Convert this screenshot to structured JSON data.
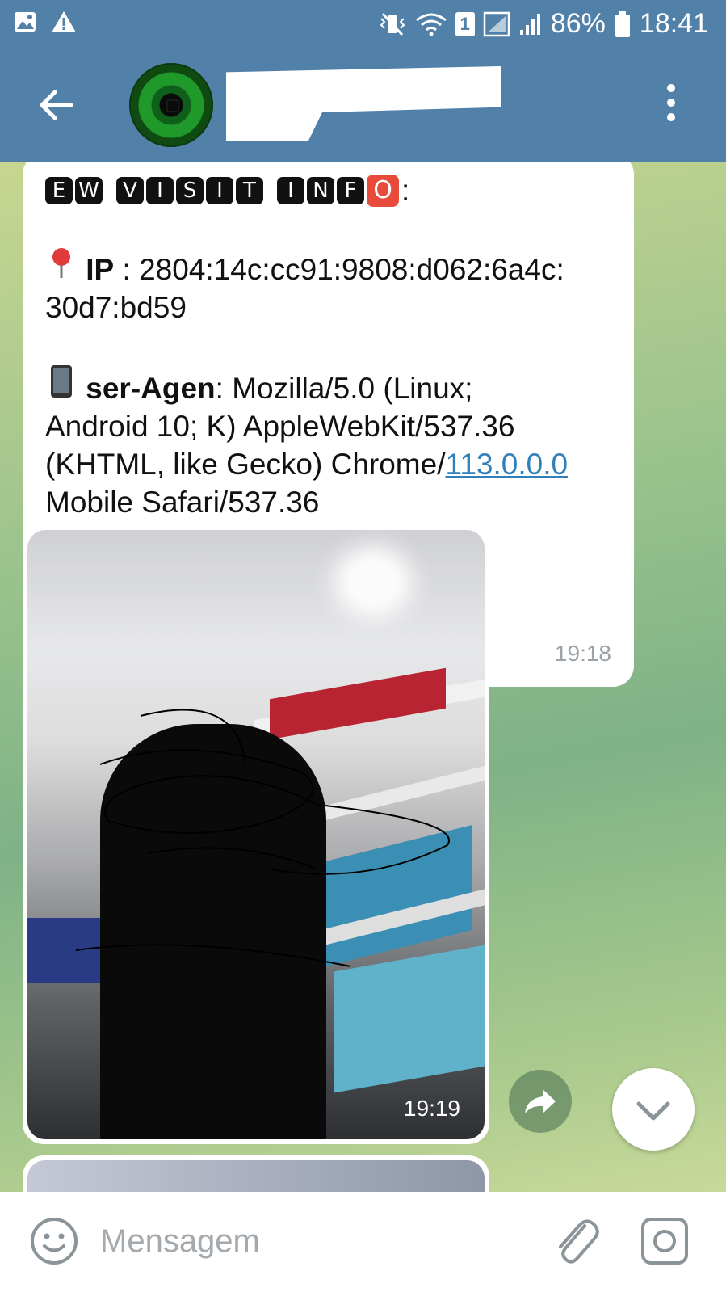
{
  "status_bar": {
    "battery": "86%",
    "time": "18:41",
    "sim_badge": "1"
  },
  "app_bar": {
    "chat_title": ""
  },
  "messages": [
    {
      "heading_tiles": [
        "E",
        "W",
        "V",
        "I",
        "S",
        "I",
        "T",
        "I",
        "N",
        "F",
        "O"
      ],
      "heading_suffix": ":",
      "ip_label": "IP",
      "ip_sep": " : ",
      "ip_value_line1": "2804:14c:cc91:9808:d062:6a4c:",
      "ip_value_line2": "30d7:bd59",
      "ua_label": "ser-Agen",
      "ua_sep": ":  ",
      "ua_line1": "Mozilla/5.0 (Linux;",
      "ua_line2": "Android 10; K) AppleWebKit/537.36",
      "ua_line3_prefix": "(KHTML, like Gecko) Chrome/",
      "ua_line3_link": "113.0.0.0",
      "ua_line4": "Mobile Safari/537.36",
      "time": "19:18"
    },
    {
      "type": "photo",
      "time": "19:19"
    }
  ],
  "input_bar": {
    "placeholder": "Mensagem"
  },
  "icons": {
    "back": "arrow-left-icon",
    "menu": "more-vertical-icon",
    "share": "forward-icon",
    "scroll": "chevron-down-icon",
    "emoji": "smiley-icon",
    "attach": "paperclip-icon",
    "camera": "instagram-camera-icon"
  },
  "colors": {
    "header": "#5181a9",
    "link": "#2f7fb8",
    "heading_accent": "#e84b3c"
  }
}
